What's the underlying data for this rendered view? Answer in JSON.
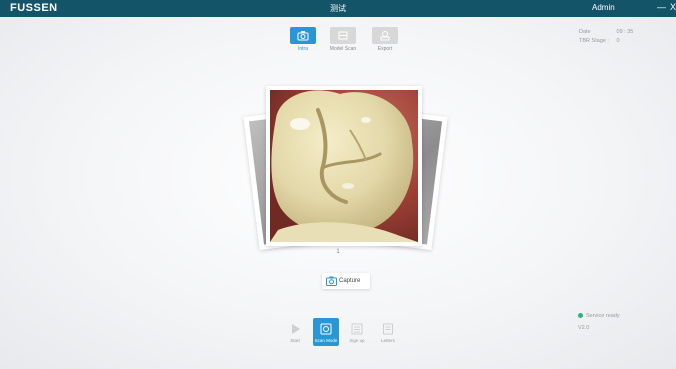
{
  "window": {
    "logo": "FUSSEN",
    "title": "测试",
    "user": "Admin",
    "minimize_label": "—",
    "close_label": "X"
  },
  "mode_tabs": [
    {
      "label": "Intra",
      "icon": "camera-icon",
      "active": true
    },
    {
      "label": "Model Scan",
      "icon": "model-icon",
      "active": false
    },
    {
      "label": "Export",
      "icon": "export-icon",
      "active": false
    }
  ],
  "info_panel": {
    "rows": [
      {
        "key": "Date",
        "value": "09 : 35"
      },
      {
        "key": "TBR Stage :",
        "value": "0"
      }
    ]
  },
  "gallery": {
    "page_indicator": "1"
  },
  "capture_button": {
    "label": "Capture",
    "icon": "capture-icon"
  },
  "status": {
    "text": "Service ready",
    "version": "V2.0"
  },
  "bottom_toolbar": [
    {
      "label": "Start",
      "icon": "play-icon",
      "active": false
    },
    {
      "label": "Scan Mode",
      "icon": "scan-icon",
      "active": true
    },
    {
      "label": "Sign up",
      "icon": "list-icon",
      "active": false
    },
    {
      "label": "Letters",
      "icon": "doc-icon",
      "active": false
    }
  ],
  "colors": {
    "titlebar": "#145468",
    "accent": "#2b96d6",
    "status_ok": "#2ab37a"
  }
}
